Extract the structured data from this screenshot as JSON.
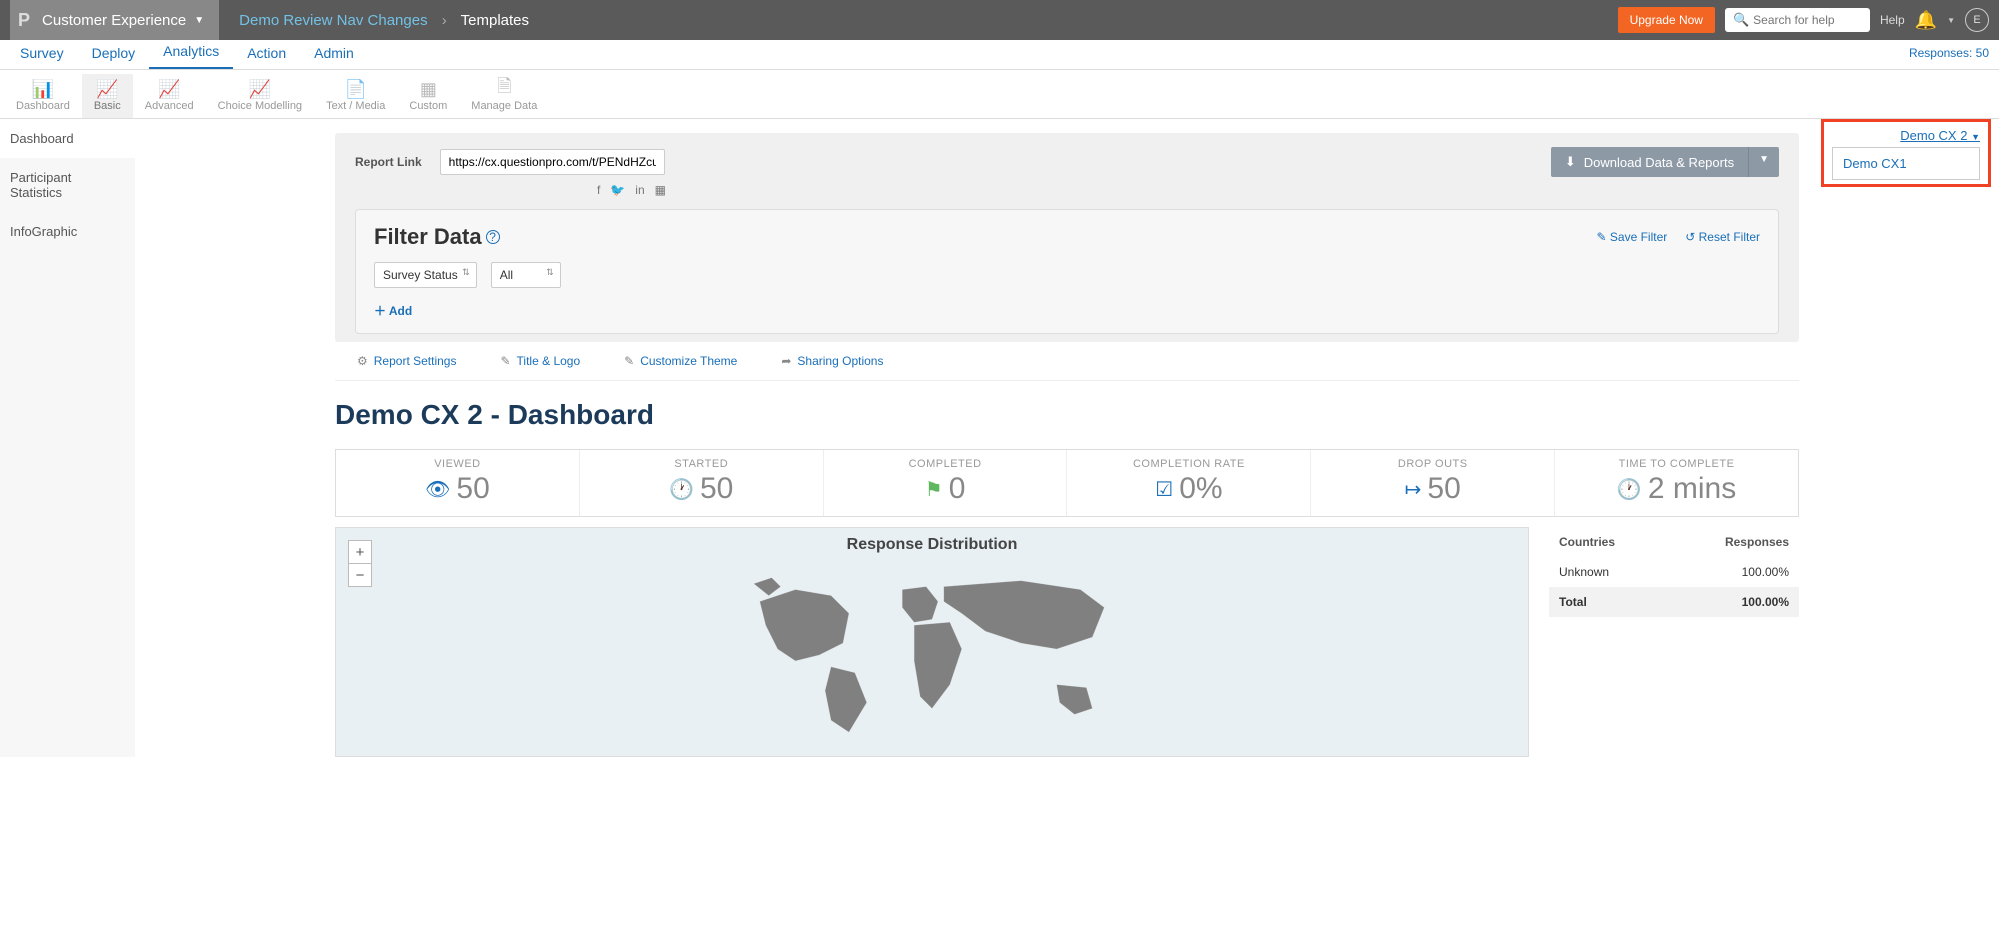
{
  "topbar": {
    "brand": "Customer Experience",
    "crumb1": "Demo Review Nav Changes",
    "crumb2": "Templates",
    "upgrade": "Upgrade Now",
    "search_ph": "Search for help",
    "help": "Help",
    "avatar": "E"
  },
  "tabs1": {
    "items": [
      "Survey",
      "Deploy",
      "Analytics",
      "Action",
      "Admin"
    ],
    "active": 2,
    "responses_label": "Responses: 50"
  },
  "tabs2": {
    "items": [
      "Dashboard",
      "Basic",
      "Advanced",
      "Choice Modelling",
      "Text / Media",
      "Custom",
      "Manage Data"
    ],
    "active": 1
  },
  "sidebar": {
    "items": [
      "Dashboard",
      "Participant Statistics",
      "InfoGraphic"
    ],
    "active": 0
  },
  "report": {
    "label": "Report Link",
    "url": "https://cx.questionpro.com/t/PENdHZcumI",
    "download": "Download Data & Reports"
  },
  "filter": {
    "title": "Filter Data",
    "save": "Save Filter",
    "reset": "Reset Filter",
    "sel1": "Survey Status",
    "sel2": "All",
    "add": "Add"
  },
  "opttabs": [
    "Report Settings",
    "Title & Logo",
    "Customize Theme",
    "Sharing Options"
  ],
  "dash_title": "Demo CX 2 - Dashboard",
  "stats": [
    {
      "label": "VIEWED",
      "value": "50",
      "icon": "eye"
    },
    {
      "label": "STARTED",
      "value": "50",
      "icon": "clock"
    },
    {
      "label": "COMPLETED",
      "value": "0",
      "icon": "flag"
    },
    {
      "label": "COMPLETION RATE",
      "value": "0%",
      "icon": "check"
    },
    {
      "label": "DROP OUTS",
      "value": "50",
      "icon": "exit"
    },
    {
      "label": "TIME TO COMPLETE",
      "value": "2 mins",
      "icon": "clock"
    }
  ],
  "map": {
    "title": "Response Distribution"
  },
  "ctable": {
    "h1": "Countries",
    "h2": "Responses",
    "rows": [
      {
        "c1": "Unknown",
        "c2": "100.00%"
      }
    ],
    "t1": "Total",
    "t2": "100.00%"
  },
  "cx_dd": {
    "current": "Demo CX 2",
    "option": "Demo CX1"
  }
}
